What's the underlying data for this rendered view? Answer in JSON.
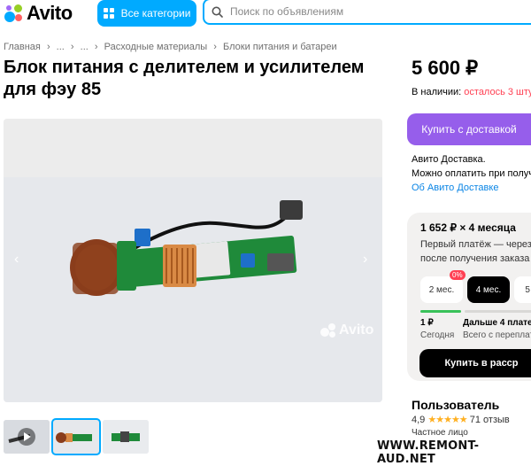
{
  "header": {
    "logo_text": "Avito",
    "categories_label": "Все категории",
    "search_placeholder": "Поиск по объявлениям"
  },
  "breadcrumbs": [
    "Главная",
    "›",
    "...",
    "›",
    "...",
    "›",
    "Расходные материалы",
    "›",
    "Блоки питания и батареи"
  ],
  "listing": {
    "title": "Блок питания с делителем и усилителем для фэу 85",
    "price": "5 600 ₽",
    "stock_prefix": "В наличии: ",
    "stock_value": "осталось 3 шту",
    "delivery_button": "Купить с доставкой",
    "delivery_lines": [
      "Авито Доставка.",
      "Можно оплатить при получ"
    ],
    "delivery_link": "Об Авито Доставке"
  },
  "installment": {
    "headline": "1 652 ₽ × 4 месяца",
    "sub_lines": [
      "Первый платёж — через З",
      "после получения заказа"
    ],
    "options": [
      "2 мес.",
      "4 мес.",
      "5 м"
    ],
    "selected_option": "4 мес.",
    "badge": "0%",
    "pay_now_amount": "1 ₽",
    "pay_now_label": "Сегодня",
    "later_label": "Дальше 4 платеж",
    "later_sub": "Всего с переплат",
    "buy_button": "Купить в расср"
  },
  "seller": {
    "name": "Пользователь",
    "rating": "4,9",
    "stars": "★★★★★",
    "reviews": "71 отзыв",
    "type": "Частное лицо"
  },
  "gallery": {
    "watermark": "Avito",
    "prev_arrow": "‹",
    "next_arrow": "›",
    "thumbnail_count": 3,
    "active_thumbnail": 2
  },
  "site_stamp": "WWW.REMONT-AUD.NET",
  "colors": {
    "accent_blue": "#00aaff",
    "delivery_purple": "#965eeb",
    "stock_red": "#ff4053",
    "link_blue": "#0a85e5",
    "star_yellow": "#ffb021"
  }
}
